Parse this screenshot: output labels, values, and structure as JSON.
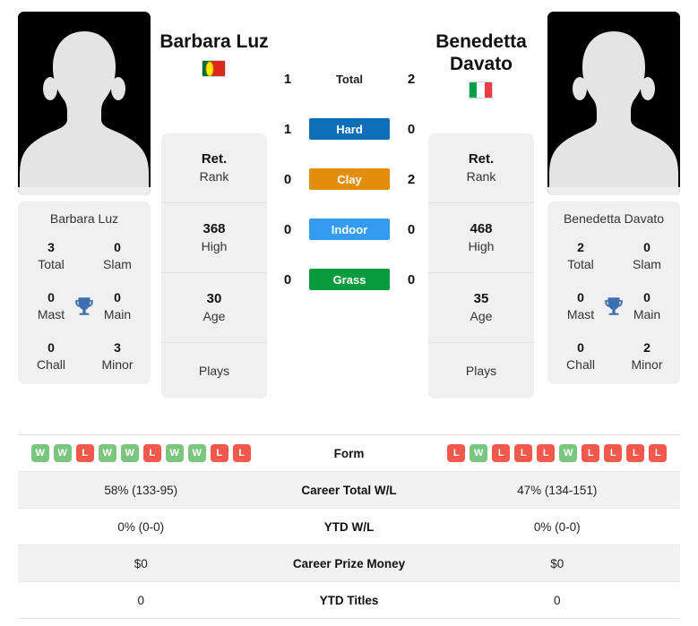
{
  "players": {
    "left": {
      "name": "Barbara Luz",
      "name_line1": "Barbara Luz",
      "flag": "portugal-flag",
      "card_name": "Barbara Luz",
      "rank": {
        "value": "Ret.",
        "label": "Rank"
      },
      "high": {
        "value": "368",
        "label": "High"
      },
      "age": {
        "value": "30",
        "label": "Age"
      },
      "plays": {
        "value": "",
        "label": "Plays"
      },
      "titles": {
        "total": {
          "value": "3",
          "label": "Total"
        },
        "slam": {
          "value": "0",
          "label": "Slam"
        },
        "mast": {
          "value": "0",
          "label": "Mast"
        },
        "main": {
          "value": "0",
          "label": "Main"
        },
        "chall": {
          "value": "0",
          "label": "Chall"
        },
        "minor": {
          "value": "3",
          "label": "Minor"
        }
      },
      "form": [
        "W",
        "W",
        "L",
        "W",
        "W",
        "L",
        "W",
        "W",
        "L",
        "L"
      ],
      "career_wl": "58% (133-95)",
      "ytd_wl": "0% (0-0)",
      "career_prize": "$0",
      "ytd_titles": "0"
    },
    "right": {
      "name": "Benedetta Davato",
      "name_line1": "Benedetta",
      "name_line2": "Davato",
      "flag": "italy-flag",
      "card_name": "Benedetta Davato",
      "rank": {
        "value": "Ret.",
        "label": "Rank"
      },
      "high": {
        "value": "468",
        "label": "High"
      },
      "age": {
        "value": "35",
        "label": "Age"
      },
      "plays": {
        "value": "",
        "label": "Plays"
      },
      "titles": {
        "total": {
          "value": "2",
          "label": "Total"
        },
        "slam": {
          "value": "0",
          "label": "Slam"
        },
        "mast": {
          "value": "0",
          "label": "Mast"
        },
        "main": {
          "value": "0",
          "label": "Main"
        },
        "chall": {
          "value": "0",
          "label": "Chall"
        },
        "minor": {
          "value": "2",
          "label": "Minor"
        }
      },
      "form": [
        "L",
        "W",
        "L",
        "L",
        "L",
        "W",
        "L",
        "L",
        "L",
        "L"
      ],
      "career_wl": "47% (134-151)",
      "ytd_wl": "0% (0-0)",
      "career_prize": "$0",
      "ytd_titles": "0"
    }
  },
  "h2h": [
    {
      "label": "Total",
      "left": "1",
      "right": "2",
      "style": "plain",
      "color": ""
    },
    {
      "label": "Hard",
      "left": "1",
      "right": "0",
      "style": "bar",
      "color": "#0e6eb8"
    },
    {
      "label": "Clay",
      "left": "0",
      "right": "2",
      "style": "bar",
      "color": "#e08e0b"
    },
    {
      "label": "Indoor",
      "left": "0",
      "right": "0",
      "style": "bar",
      "color": "#349bf0"
    },
    {
      "label": "Grass",
      "left": "0",
      "right": "0",
      "style": "bar",
      "color": "#0a9b3e"
    }
  ],
  "stats_rows": [
    {
      "label": "Form",
      "type": "form"
    },
    {
      "label": "Career Total W/L",
      "type": "text",
      "key": "career_wl"
    },
    {
      "label": "YTD W/L",
      "type": "text",
      "key": "ytd_wl"
    },
    {
      "label": "Career Prize Money",
      "type": "text",
      "key": "career_prize"
    },
    {
      "label": "YTD Titles",
      "type": "text",
      "key": "ytd_titles"
    }
  ],
  "icons": {
    "trophy": "trophy-icon",
    "avatar": "player-avatar-silhouette"
  },
  "colors": {
    "win_badge": "#7bc67e",
    "loss_badge": "#f0594c",
    "trophy": "#3d6fb0",
    "card_bg": "#f0f0f0",
    "row_shade": "#f2f2f2"
  }
}
